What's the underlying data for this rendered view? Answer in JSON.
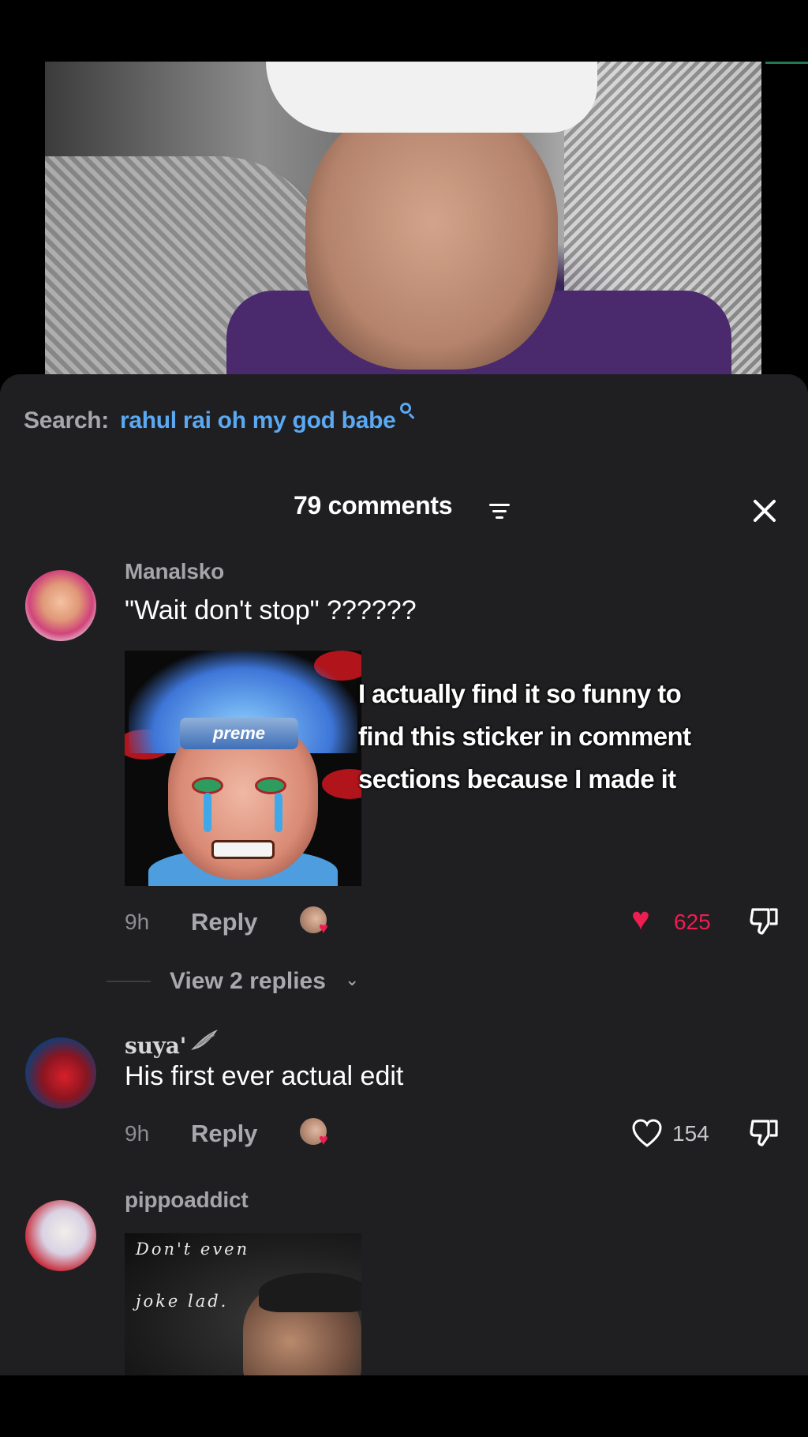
{
  "search": {
    "prefix": "Search:",
    "query": "rahul rai oh my god babe",
    "icon": "search-icon"
  },
  "panel": {
    "comment_count_label": "79 comments",
    "sort_icon": "filter-icon",
    "close_icon": "close-icon"
  },
  "comments": [
    {
      "username": "Manalsko",
      "text": "\"Wait don't stop\" ??????",
      "has_sticker": true,
      "sticker_text": "preme",
      "time": "9h",
      "reply_label": "Reply",
      "liked": true,
      "like_count": "625",
      "view_replies_label": "View 2 replies"
    },
    {
      "username": "suya'",
      "text": "His first ever actual edit",
      "time": "9h",
      "reply_label": "Reply",
      "liked": false,
      "like_count": "154"
    },
    {
      "username": "pippoaddict",
      "meme_lines": [
        "Don't even",
        "joke lad."
      ]
    }
  ],
  "overlay_caption": {
    "lines": [
      "I actually find it so funny to",
      "find this sticker in comment",
      "sections because I made it"
    ]
  },
  "colors": {
    "sheet_bg": "#1f1f21",
    "accent_blue": "#5aa9f2",
    "like_red": "#ee1d52",
    "muted_text": "#a5a5a9"
  }
}
